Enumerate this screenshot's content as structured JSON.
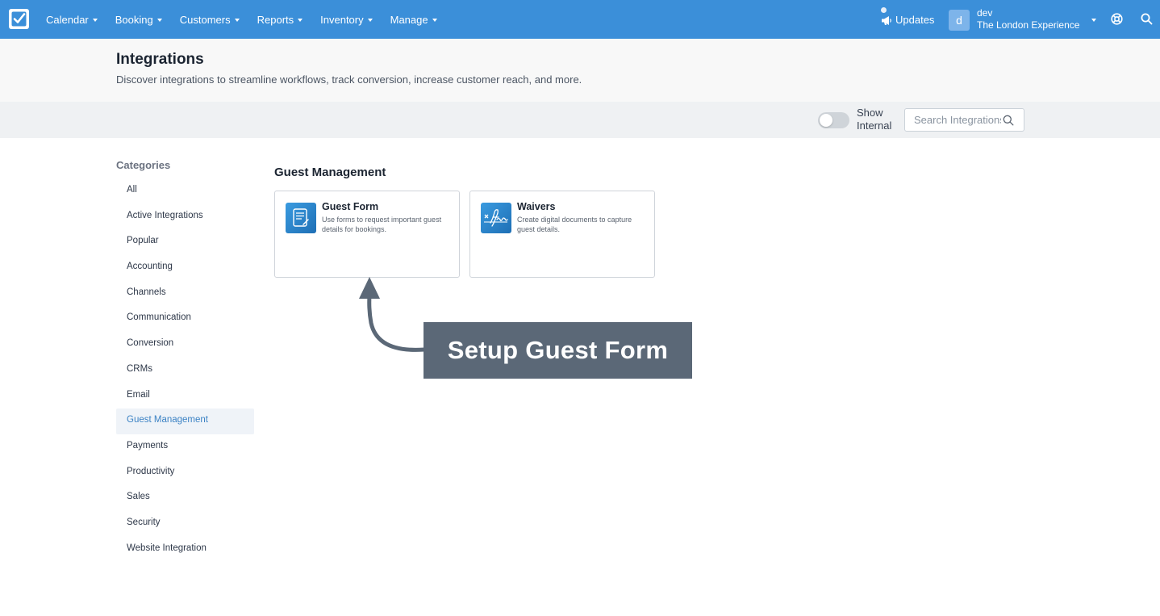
{
  "nav": {
    "items": [
      {
        "label": "Calendar"
      },
      {
        "label": "Booking"
      },
      {
        "label": "Customers"
      },
      {
        "label": "Reports"
      },
      {
        "label": "Inventory"
      },
      {
        "label": "Manage"
      }
    ],
    "updates_label": "Updates",
    "avatar_initial": "d",
    "user_name": "dev",
    "org_name": "The London Experience"
  },
  "header": {
    "title": "Integrations",
    "subtitle": "Discover integrations to streamline workflows, track conversion, increase customer reach, and more."
  },
  "filters": {
    "toggle_label": "Show Internal",
    "toggle_on": false,
    "search_placeholder": "Search Integrations"
  },
  "sidebar": {
    "title": "Categories",
    "items": [
      {
        "label": "All"
      },
      {
        "label": "Active Integrations"
      },
      {
        "label": "Popular"
      },
      {
        "label": "Accounting"
      },
      {
        "label": "Channels"
      },
      {
        "label": "Communication"
      },
      {
        "label": "Conversion"
      },
      {
        "label": "CRMs"
      },
      {
        "label": "Email"
      },
      {
        "label": "Guest Management"
      },
      {
        "label": "Payments"
      },
      {
        "label": "Productivity"
      },
      {
        "label": "Sales"
      },
      {
        "label": "Security"
      },
      {
        "label": "Website Integration"
      }
    ],
    "active": "Guest Management"
  },
  "main": {
    "section_title": "Guest Management",
    "cards": [
      {
        "name": "Guest Form",
        "description": "Use forms to request important guest details for bookings.",
        "icon": "form-icon"
      },
      {
        "name": "Waivers",
        "description": "Create digital documents to capture guest details.",
        "icon": "signature-icon"
      }
    ]
  },
  "callout": {
    "text": "Setup Guest Form"
  },
  "colors": {
    "topbar": "#3b8fd9",
    "accent": "#3b82c4",
    "callout": "#5b6877"
  }
}
